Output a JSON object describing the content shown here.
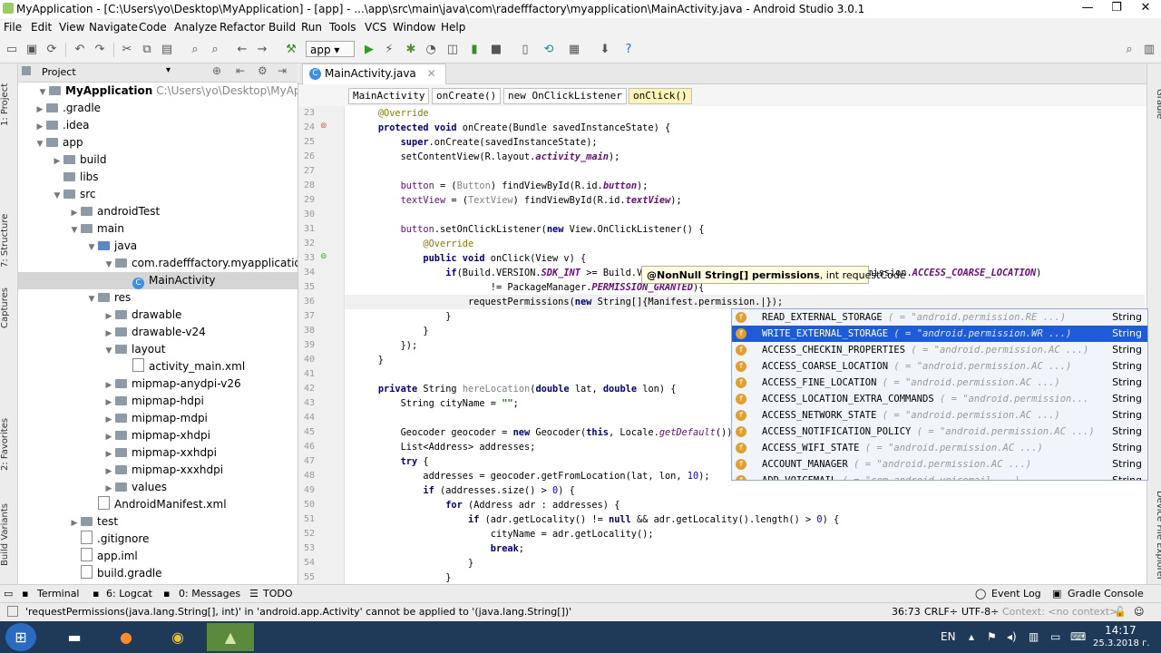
{
  "window": {
    "title": "MyApplication - [C:\\Users\\yo\\Desktop\\MyApplication] - [app] - ...\\app\\src\\main\\java\\com\\radefffactory\\myapplication\\MainActivity.java - Android Studio 3.0.1",
    "minimize": "—",
    "maximize": "❐",
    "close": "✕"
  },
  "menu": [
    "File",
    "Edit",
    "View",
    "Navigate",
    "Code",
    "Analyze",
    "Refactor",
    "Build",
    "Run",
    "Tools",
    "VCS",
    "Window",
    "Help"
  ],
  "toolbar": {
    "run_config": "app"
  },
  "left_strip": [
    "1: Project",
    "7: Structure",
    "Captures",
    "2: Favorites",
    "Build Variants"
  ],
  "right_strip": [
    "Gradle",
    "Device File Explorer"
  ],
  "project_panel": {
    "view": "Project",
    "root_name": "MyApplication",
    "root_path": "C:\\Users\\yo\\Desktop\\MyApplication",
    "items": [
      {
        "label": "MyApplication",
        "depth": 0,
        "expanded": true,
        "type": "folder"
      },
      {
        "label": ".gradle",
        "depth": 1,
        "expanded": false,
        "type": "folder"
      },
      {
        "label": ".idea",
        "depth": 1,
        "expanded": false,
        "type": "folder"
      },
      {
        "label": "app",
        "depth": 1,
        "expanded": true,
        "type": "folder"
      },
      {
        "label": "build",
        "depth": 2,
        "expanded": false,
        "type": "folder"
      },
      {
        "label": "libs",
        "depth": 2,
        "expanded": null,
        "type": "folder"
      },
      {
        "label": "src",
        "depth": 2,
        "expanded": true,
        "type": "folder"
      },
      {
        "label": "androidTest",
        "depth": 3,
        "expanded": false,
        "type": "folder"
      },
      {
        "label": "main",
        "depth": 3,
        "expanded": true,
        "type": "folder"
      },
      {
        "label": "java",
        "depth": 4,
        "expanded": true,
        "type": "folder-blue"
      },
      {
        "label": "com.radefffactory.myapplication",
        "depth": 5,
        "expanded": true,
        "type": "package"
      },
      {
        "label": "MainActivity",
        "depth": 6,
        "expanded": null,
        "type": "class",
        "selected": true
      },
      {
        "label": "res",
        "depth": 4,
        "expanded": true,
        "type": "folder"
      },
      {
        "label": "drawable",
        "depth": 5,
        "expanded": false,
        "type": "folder"
      },
      {
        "label": "drawable-v24",
        "depth": 5,
        "expanded": false,
        "type": "folder"
      },
      {
        "label": "layout",
        "depth": 5,
        "expanded": true,
        "type": "folder"
      },
      {
        "label": "activity_main.xml",
        "depth": 6,
        "expanded": null,
        "type": "file"
      },
      {
        "label": "mipmap-anydpi-v26",
        "depth": 5,
        "expanded": false,
        "type": "folder"
      },
      {
        "label": "mipmap-hdpi",
        "depth": 5,
        "expanded": false,
        "type": "folder"
      },
      {
        "label": "mipmap-mdpi",
        "depth": 5,
        "expanded": false,
        "type": "folder"
      },
      {
        "label": "mipmap-xhdpi",
        "depth": 5,
        "expanded": false,
        "type": "folder"
      },
      {
        "label": "mipmap-xxhdpi",
        "depth": 5,
        "expanded": false,
        "type": "folder"
      },
      {
        "label": "mipmap-xxxhdpi",
        "depth": 5,
        "expanded": false,
        "type": "folder"
      },
      {
        "label": "values",
        "depth": 5,
        "expanded": false,
        "type": "folder"
      },
      {
        "label": "AndroidManifest.xml",
        "depth": 4,
        "expanded": null,
        "type": "file"
      },
      {
        "label": "test",
        "depth": 3,
        "expanded": false,
        "type": "folder"
      },
      {
        "label": ".gitignore",
        "depth": 2,
        "expanded": null,
        "type": "file"
      },
      {
        "label": "app.iml",
        "depth": 2,
        "expanded": null,
        "type": "file"
      },
      {
        "label": "build.gradle",
        "depth": 2,
        "expanded": null,
        "type": "file"
      }
    ]
  },
  "editor": {
    "tab": "MainActivity.java",
    "breadcrumbs": [
      "MainActivity",
      "onCreate()",
      "new OnClickListener",
      "onClick()"
    ],
    "lines": [
      {
        "n": "23",
        "html": "    <span class='an'>@Override</span>"
      },
      {
        "n": "24",
        "html": "    <span class='kw'>protected void</span> onCreate(Bundle savedInstanceState) {"
      },
      {
        "n": "25",
        "html": "        <span class='kw'>super</span>.onCreate(savedInstanceState);"
      },
      {
        "n": "26",
        "html": "        setContentView(R.layout.<span class='fnb'>activity_main</span>);"
      },
      {
        "n": "27",
        "html": ""
      },
      {
        "n": "28",
        "html": "        <span class='fn' style='color:#660e7a;font-style:normal'>button</span> = (<span class='gr'>Button</span>) findViewById(R.id.<span class='fnb'>button</span>);"
      },
      {
        "n": "29",
        "html": "        <span style='color:#660e7a'>textView</span> = (<span class='gr'>TextView</span>) findViewById(R.id.<span class='fnb'>textView</span>);"
      },
      {
        "n": "30",
        "html": ""
      },
      {
        "n": "31",
        "html": "        <span style='color:#660e7a'>button</span>.setOnClickListener(<span class='kw'>new</span> View.OnClickListener() {"
      },
      {
        "n": "32",
        "html": "            <span class='an'>@Override</span>"
      },
      {
        "n": "33",
        "html": "            <span class='kw'>public void</span> onClick(View v) {"
      },
      {
        "n": "34",
        "html": "                <span class='kw'>if</span>(Build.VERSION.<span class='fnb'>SDK_INT</span> &gt;= Build.VE                           Manifest.permission.<span class='fnb'>ACCESS_COARSE_LOCATION</span>)"
      },
      {
        "n": "35",
        "html": "                        != PackageManager.<span class='fnb'>PERMISSION_GRANTED</span>){"
      },
      {
        "n": "36",
        "html": "                    requestPermissions(<span class='kw'>new</span> String[]{Manifest.permission.|});"
      },
      {
        "n": "37",
        "html": "                }"
      },
      {
        "n": "38",
        "html": "            }"
      },
      {
        "n": "39",
        "html": "        });"
      },
      {
        "n": "40",
        "html": "    }"
      },
      {
        "n": "41",
        "html": ""
      },
      {
        "n": "42",
        "html": "    <span class='kw'>private</span> String <span class='gr'>hereLocation</span>(<span class='kw'>double</span> lat, <span class='kw'>double</span> lon) {"
      },
      {
        "n": "43",
        "html": "        String cityName = <span class='str'>\"\"</span>;"
      },
      {
        "n": "44",
        "html": ""
      },
      {
        "n": "45",
        "html": "        Geocoder geocoder = <span class='kw'>new</span> Geocoder(<span class='kw'>this</span>, Locale.<span class='fn'>getDefault</span>());"
      },
      {
        "n": "46",
        "html": "        List&lt;Address&gt; addresses;"
      },
      {
        "n": "47",
        "html": "        <span class='kw'>try</span> {"
      },
      {
        "n": "48",
        "html": "            addresses = geocoder.getFromLocation(lat, lon, <span style='color:#0000ff'>10</span>);"
      },
      {
        "n": "49",
        "html": "            <span class='kw'>if</span> (addresses.size() &gt; <span style='color:#0000ff'>0</span>) {"
      },
      {
        "n": "50",
        "html": "                <span class='kw'>for</span> (Address adr : addresses) {"
      },
      {
        "n": "51",
        "html": "                    <span class='kw'>if</span> (adr.getLocality() != <span class='kw'>null</span> &amp;&amp; adr.getLocality().length() &gt; <span style='color:#0000ff'>0</span>) {"
      },
      {
        "n": "52",
        "html": "                        cityName = adr.getLocality();"
      },
      {
        "n": "53",
        "html": "                        <span class='kw'>break</span>;"
      },
      {
        "n": "54",
        "html": "                    }"
      },
      {
        "n": "55",
        "html": "                }"
      }
    ]
  },
  "param_info": {
    "bold": "@NonNull String[] permissions",
    "rest": ", int requestCode"
  },
  "completion": [
    {
      "name": "READ_EXTERNAL_STORAGE",
      "value": "( = \"android.permission.RE ...)",
      "type": "String",
      "selected": false
    },
    {
      "name": "WRITE_EXTERNAL_STORAGE",
      "value": "( = \"android.permission.WR ...)",
      "type": "String",
      "selected": true
    },
    {
      "name": "ACCESS_CHECKIN_PROPERTIES",
      "value": "( = \"android.permission.AC ...)",
      "type": "String",
      "selected": false
    },
    {
      "name": "ACCESS_COARSE_LOCATION",
      "value": "( = \"android.permission.AC ...)",
      "type": "String",
      "selected": false
    },
    {
      "name": "ACCESS_FINE_LOCATION",
      "value": "( = \"android.permission.AC ...)",
      "type": "String",
      "selected": false
    },
    {
      "name": "ACCESS_LOCATION_EXTRA_COMMANDS",
      "value": "( = \"android.permission...",
      "type": "String",
      "selected": false
    },
    {
      "name": "ACCESS_NETWORK_STATE",
      "value": "( = \"android.permission.AC ...)",
      "type": "String",
      "selected": false
    },
    {
      "name": "ACCESS_NOTIFICATION_POLICY",
      "value": "( = \"android.permission.AC ...)",
      "type": "String",
      "selected": false
    },
    {
      "name": "ACCESS_WIFI_STATE",
      "value": "( = \"android.permission.AC ...)",
      "type": "String",
      "selected": false
    },
    {
      "name": "ACCOUNT_MANAGER",
      "value": "( = \"android.permission.AC ...)",
      "type": "String",
      "selected": false
    },
    {
      "name": "ADD_VOICEMAIL",
      "value": "( = \"com.android.voicemail ...)",
      "type": "String",
      "selected": false
    }
  ],
  "bottom_tabs": {
    "terminal": "Terminal",
    "logcat": "6: Logcat",
    "messages": "0: Messages",
    "todo": "TODO",
    "event_log": "Event Log",
    "gradle_console": "Gradle Console"
  },
  "status": {
    "message": "'requestPermissions(java.lang.String[], int)' in 'android.app.Activity' cannot be applied to '(java.lang.String[])'",
    "position": "36:73",
    "line_sep": "CRLF÷",
    "encoding": "UTF-8÷",
    "context": "Context: <no context>"
  },
  "taskbar": {
    "lang": "EN",
    "time": "14:17",
    "date": "25.3.2018 г."
  }
}
